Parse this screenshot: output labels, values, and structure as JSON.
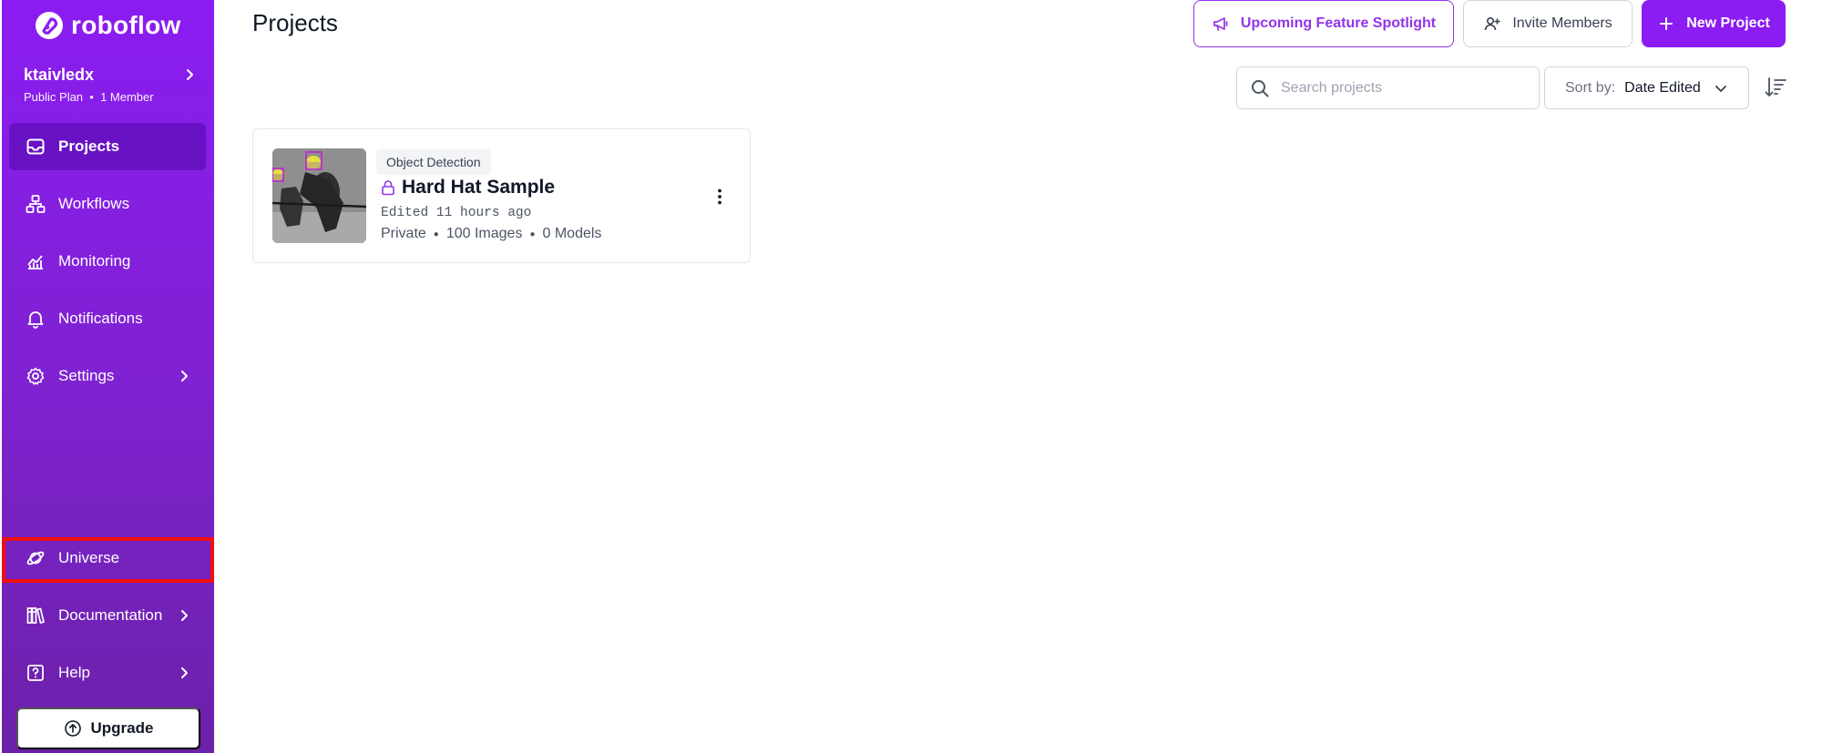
{
  "brand": {
    "name": "roboflow"
  },
  "workspace": {
    "name": "ktaivledx",
    "plan": "Public Plan",
    "members": "1 Member"
  },
  "sidebar": {
    "items": [
      {
        "label": "Projects",
        "icon": "inbox-icon",
        "active": true
      },
      {
        "label": "Workflows",
        "icon": "workflow-icon"
      },
      {
        "label": "Monitoring",
        "icon": "chart-icon"
      },
      {
        "label": "Notifications",
        "icon": "bell-icon"
      },
      {
        "label": "Settings",
        "icon": "gear-icon",
        "expandable": true
      }
    ],
    "bottom_items": [
      {
        "label": "Universe",
        "icon": "planet-icon",
        "highlighted": true
      },
      {
        "label": "Documentation",
        "icon": "books-icon",
        "expandable": true
      },
      {
        "label": "Help",
        "icon": "help-icon",
        "expandable": true
      }
    ],
    "upgrade_label": "Upgrade"
  },
  "header": {
    "title": "Projects",
    "spotlight_label": "Upcoming Feature Spotlight",
    "invite_label": "Invite Members",
    "new_project_label": "New Project"
  },
  "search": {
    "placeholder": "Search projects",
    "value": ""
  },
  "sort": {
    "label": "Sort by:",
    "value": "Date Edited"
  },
  "projects": [
    {
      "type": "Object Detection",
      "name": "Hard Hat Sample",
      "edited": "Edited 11 hours ago",
      "visibility": "Private",
      "images": "100 Images",
      "models": "0 Models"
    }
  ],
  "colors": {
    "sidebar_top": "#8b1cf2",
    "sidebar_bottom": "#6b21a8",
    "accent": "#9333ea",
    "highlight_box": "#ef1010"
  }
}
